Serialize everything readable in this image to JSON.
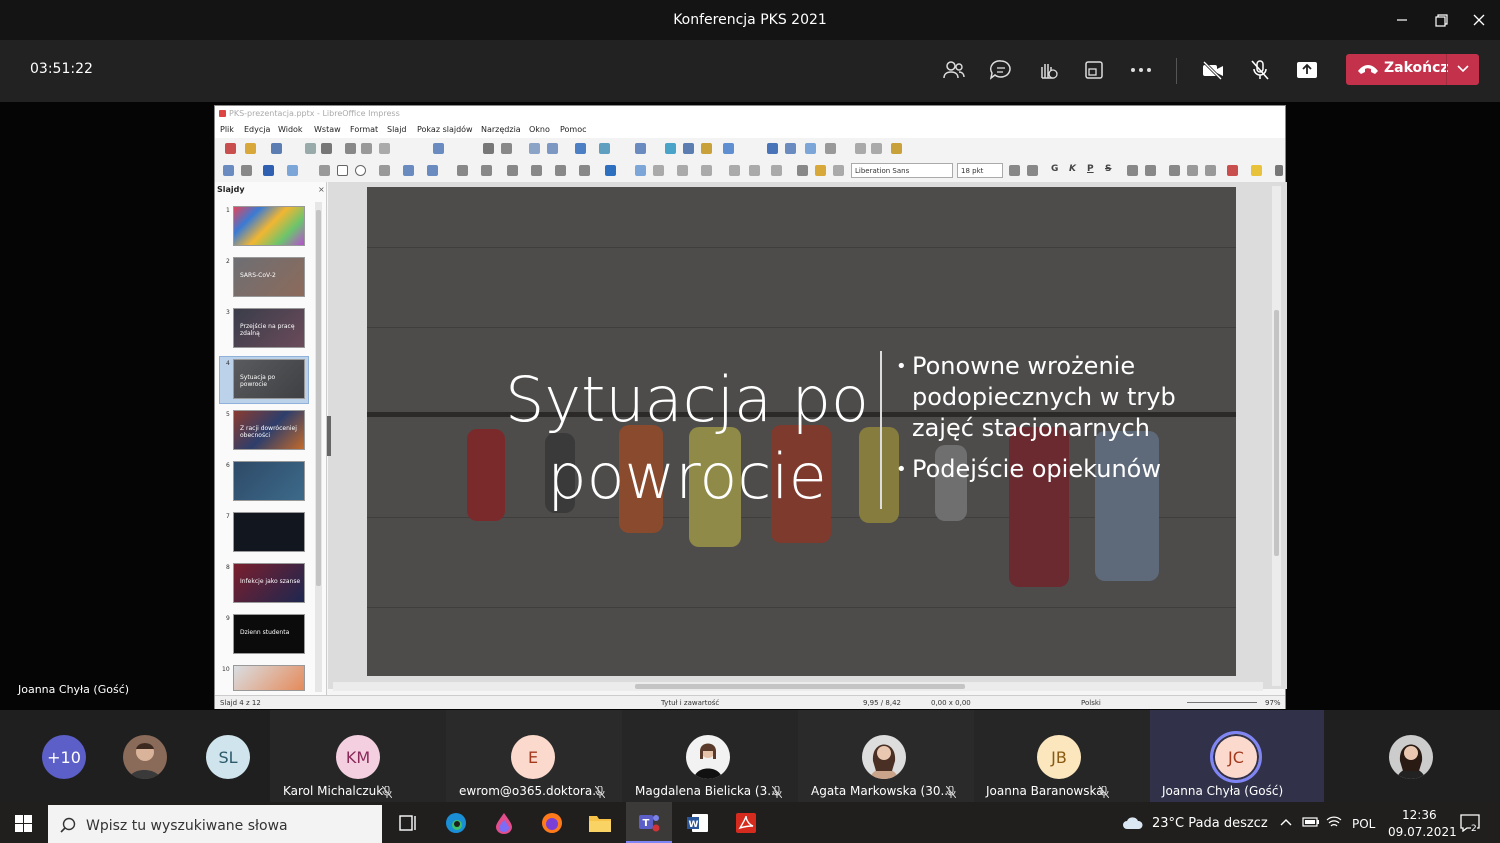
{
  "window": {
    "title": "Konferencja PKS 2021"
  },
  "controls": {
    "timer": "03:51:22",
    "end_label": "Zakończ"
  },
  "presenter_label": "Joanna Chyła (Gość)",
  "libreoffice": {
    "title": "PKS-prezentacja.pptx - LibreOffice Impress",
    "menu": [
      "Plik",
      "Edycja",
      "Widok",
      "Wstaw",
      "Format",
      "Slajd",
      "Pokaz slajdów",
      "Narzędzia",
      "Okno",
      "Pomoc"
    ],
    "font_name": "Liberation Sans",
    "font_size": "18 pkt",
    "format_letters": [
      "G",
      "K",
      "P",
      "S"
    ],
    "slides_panel_title": "Slajdy",
    "thumbnails": [
      {
        "num": "1",
        "text": ""
      },
      {
        "num": "2",
        "text": "SARS-CoV-2"
      },
      {
        "num": "3",
        "text": "Przejście na pracę zdalną"
      },
      {
        "num": "4",
        "text": "Sytuacja po powrocie"
      },
      {
        "num": "5",
        "text": "Z racji dowróceniej obecności"
      },
      {
        "num": "6",
        "text": ""
      },
      {
        "num": "7",
        "text": ""
      },
      {
        "num": "8",
        "text": "Infekcje jako szanse"
      },
      {
        "num": "9",
        "text": "Dzienn studenta"
      },
      {
        "num": "10",
        "text": ""
      }
    ],
    "slide": {
      "title_line1": "Sytuacja po",
      "title_line2": "powrocie",
      "bullets": [
        "Ponowne wrożenie",
        "podopiecznych w tryb",
        "zajęć stacjonarnych",
        "Podejście opiekunów"
      ]
    },
    "status": {
      "slide": "Slajd 4 z 12",
      "layout": "Tytuł i zawartość",
      "position": "9,95 / 8,42",
      "size": "0,00 x 0,00",
      "language": "Polski",
      "zoom": "97%"
    }
  },
  "participants": [
    {
      "initials": "+10",
      "name": ""
    },
    {
      "initials": "",
      "name": ""
    },
    {
      "initials": "SL",
      "name": ""
    },
    {
      "initials": "KM",
      "name": "Karol Michalczuk"
    },
    {
      "initials": "E",
      "name": "ewrom@o365.doktora..."
    },
    {
      "initials": "",
      "name": "Magdalena Bielicka (3..."
    },
    {
      "initials": "",
      "name": "Agata Markowska (30..."
    },
    {
      "initials": "JB",
      "name": "Joanna Baranowska"
    },
    {
      "initials": "JC",
      "name": "Joanna Chyła (Gość)"
    },
    {
      "initials": "",
      "name": ""
    }
  ],
  "taskbar": {
    "search_placeholder": "Wpisz tu wyszukiwane słowa",
    "weather": "23°C  Pada deszcz",
    "lang": "POL",
    "time": "12:36",
    "date": "09.07.2021",
    "notifications": "2"
  },
  "colors": {
    "end_button": "#c4314b",
    "teams_accent": "#6264a7"
  }
}
